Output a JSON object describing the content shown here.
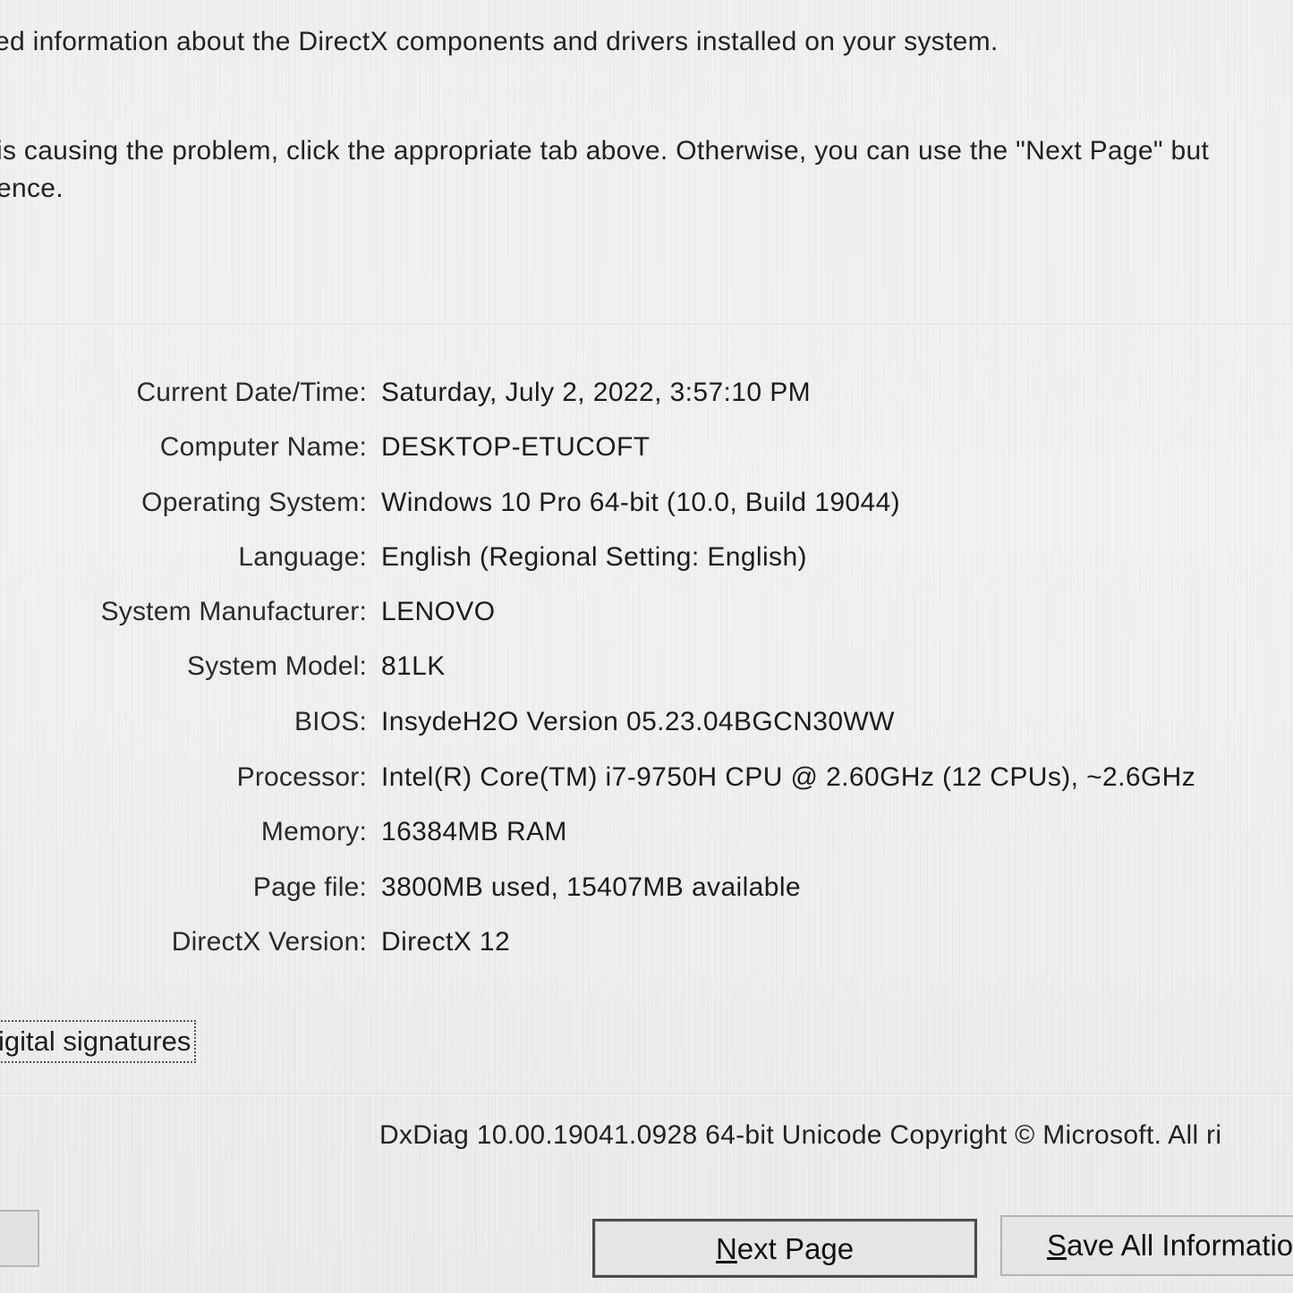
{
  "intro": {
    "line1": "ed information about the DirectX components and drivers installed on your system.",
    "line2": "is causing the problem, click the appropriate tab above.  Otherwise, you can use the \"Next Page\" but",
    "line3": "ence."
  },
  "system_info": [
    {
      "label": "Current Date/Time:",
      "value": "Saturday, July 2, 2022, 3:57:10 PM"
    },
    {
      "label": "Computer Name:",
      "value": "DESKTOP-ETUCOFT"
    },
    {
      "label": "Operating System:",
      "value": "Windows 10 Pro 64-bit (10.0, Build 19044)"
    },
    {
      "label": "Language:",
      "value": "English (Regional Setting: English)"
    },
    {
      "label": "System Manufacturer:",
      "value": "LENOVO"
    },
    {
      "label": "System Model:",
      "value": "81LK"
    },
    {
      "label": "BIOS:",
      "value": "InsydeH2O Version 05.23.04BGCN30WW"
    },
    {
      "label": "Processor:",
      "value": "Intel(R) Core(TM) i7-9750H CPU @ 2.60GHz (12 CPUs), ~2.6GHz"
    },
    {
      "label": "Memory:",
      "value": "16384MB RAM"
    },
    {
      "label": "Page file:",
      "value": "3800MB used, 15407MB available"
    },
    {
      "label": "DirectX Version:",
      "value": "DirectX 12"
    }
  ],
  "checkbox": {
    "label": "igital signatures"
  },
  "footer": {
    "version_text": "DxDiag 10.00.19041.0928 64-bit Unicode  Copyright © Microsoft. All ri"
  },
  "buttons": {
    "next_page_hotkey": "N",
    "next_page_rest": "ext Page",
    "save_hotkey": "S",
    "save_rest": "ave All Informatio"
  }
}
